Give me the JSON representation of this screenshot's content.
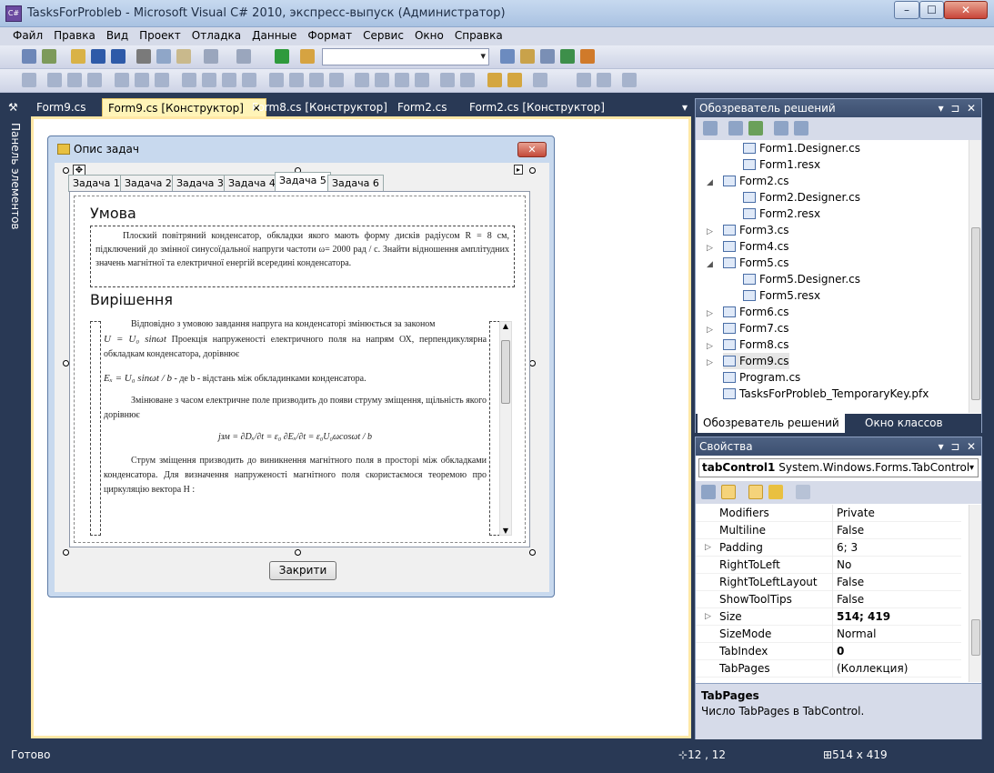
{
  "window": {
    "title": "TasksForProbleb - Microsoft Visual C# 2010, экспресс-выпуск (Администратор)",
    "app_icon": "C#",
    "caption_buttons": [
      "–",
      "☐",
      "✕"
    ]
  },
  "menu": [
    "Файл",
    "Правка",
    "Вид",
    "Проект",
    "Отладка",
    "Данные",
    "Формат",
    "Сервис",
    "Окно",
    "Справка"
  ],
  "toolbox_tab": "Панель элементов",
  "doc_tabs": [
    {
      "label": "Form9.cs",
      "active": false
    },
    {
      "label": "Form9.cs [Конструктор]",
      "active": true,
      "close": "✕"
    },
    {
      "label": "Form8.cs [Конструктор]",
      "active": false
    },
    {
      "label": "Form2.cs",
      "active": false
    },
    {
      "label": "Form2.cs [Конструктор]",
      "active": false
    }
  ],
  "doc_tabs_dropdown": "▾",
  "form": {
    "title": "Опис задач",
    "close_glyph": "✕",
    "tabs": [
      "Задача 1",
      "Задача 2",
      "Задача 3",
      "Задача 4",
      "Задача 5",
      "Задача 6"
    ],
    "selected_tab": "Задача 5",
    "condition_heading": "Умова",
    "condition_text": "Плоский повітряний конденсатор, обкладки якого мають форму дисків радіусом R = 8 см, підключений до змінної синусоїдальної напруги частоти ω= 2000 рад / c. Знайти відношення амплітудних значень магнітної та електричної енергій всередині конденсатора.",
    "solution_heading": "Вирішення",
    "solution_p1": "Відповідно з умовою завдання напруга на конденсаторі змінюється за законом",
    "formula1": "U = U₀ sinωt",
    "solution_p1b": "Проекція напруженості електричного поля на напрям ОХ, перпендикулярна обкладкам конденсатора, дорівнює",
    "formula2": "Eₓ = U₀ sinωt / b",
    "solution_p2": "- де b - відстань між обкладинками конденсатора.",
    "solution_p3": "Змінюване з часом електричне поле призводить до появи струму зміщення, щільність якого дорівнює",
    "formula3": "jзм = ∂Dₓ/∂t = ε₀ ∂Eₓ/∂t = ε₀U₀ωcosωt / b",
    "solution_p4": "Струм зміщення призводить до виникнення магнітного поля в просторі між обкладками конденсатора. Для визначення напруженості магнітного поля скористаємося теоремою про циркуляцію вектора Н :",
    "close_button": "Закрити"
  },
  "solution_explorer": {
    "title": "Обозреватель решений",
    "items": [
      {
        "label": "Form1.Designer.cs",
        "indent": 2,
        "expander": ""
      },
      {
        "label": "Form1.resx",
        "indent": 2,
        "expander": ""
      },
      {
        "label": "Form2.cs",
        "indent": 1,
        "expander": "◢"
      },
      {
        "label": "Form2.Designer.cs",
        "indent": 2,
        "expander": ""
      },
      {
        "label": "Form2.resx",
        "indent": 2,
        "expander": ""
      },
      {
        "label": "Form3.cs",
        "indent": 1,
        "expander": "▷"
      },
      {
        "label": "Form4.cs",
        "indent": 1,
        "expander": "▷"
      },
      {
        "label": "Form5.cs",
        "indent": 1,
        "expander": "◢"
      },
      {
        "label": "Form5.Designer.cs",
        "indent": 2,
        "expander": ""
      },
      {
        "label": "Form5.resx",
        "indent": 2,
        "expander": ""
      },
      {
        "label": "Form6.cs",
        "indent": 1,
        "expander": "▷"
      },
      {
        "label": "Form7.cs",
        "indent": 1,
        "expander": "▷"
      },
      {
        "label": "Form8.cs",
        "indent": 1,
        "expander": "▷"
      },
      {
        "label": "Form9.cs",
        "indent": 1,
        "expander": "▷"
      },
      {
        "label": "Program.cs",
        "indent": 1,
        "expander": ""
      },
      {
        "label": "TasksForProbleb_TemporaryKey.pfx",
        "indent": 1,
        "expander": ""
      }
    ],
    "bottom_tabs": [
      "Обозреватель решений",
      "Окно классов"
    ]
  },
  "properties": {
    "title": "Свойства",
    "object_name": "tabControl1",
    "object_type": "System.Windows.Forms.TabControl",
    "rows": [
      {
        "name": "Modifiers",
        "value": "Private",
        "bold": false,
        "expander": ""
      },
      {
        "name": "Multiline",
        "value": "False",
        "bold": false,
        "expander": ""
      },
      {
        "name": "Padding",
        "value": "6; 3",
        "bold": false,
        "expander": "▷"
      },
      {
        "name": "RightToLeft",
        "value": "No",
        "bold": false,
        "expander": ""
      },
      {
        "name": "RightToLeftLayout",
        "value": "False",
        "bold": false,
        "expander": ""
      },
      {
        "name": "ShowToolTips",
        "value": "False",
        "bold": false,
        "expander": ""
      },
      {
        "name": "Size",
        "value": "514; 419",
        "bold": true,
        "expander": "▷"
      },
      {
        "name": "SizeMode",
        "value": "Normal",
        "bold": false,
        "expander": ""
      },
      {
        "name": "TabIndex",
        "value": "0",
        "bold": true,
        "expander": ""
      },
      {
        "name": "TabPages",
        "value": "(Коллекция)",
        "bold": false,
        "expander": ""
      }
    ],
    "desc_title": "TabPages",
    "desc_text": "Число TabPages в TabControl."
  },
  "status": {
    "text": "Готово",
    "position": "12 , 12",
    "size": "514 x 419"
  }
}
